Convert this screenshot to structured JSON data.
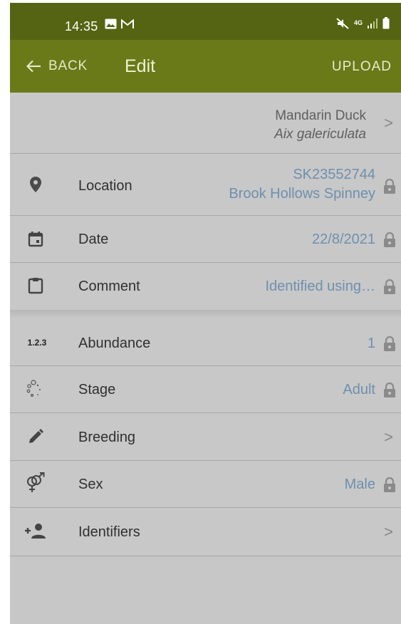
{
  "status_bar": {
    "time": "14:35",
    "network": "4G"
  },
  "app_bar": {
    "back_label": "BACK",
    "title": "Edit",
    "upload_label": "UPLOAD"
  },
  "species": {
    "common_name": "Mandarin Duck",
    "latin_name": "Aix galericulata"
  },
  "attributes": {
    "location": {
      "label": "Location",
      "grid_ref": "SK23552744",
      "place": "Brook Hollows Spinney",
      "locked": true
    },
    "date": {
      "label": "Date",
      "value": "22/8/2021",
      "locked": true
    },
    "comment": {
      "label": "Comment",
      "value": "Identified using…",
      "locked": true
    },
    "abundance": {
      "label": "Abundance",
      "value": "1",
      "locked": true,
      "icon_text": "1.2.3"
    },
    "stage": {
      "label": "Stage",
      "value": "Adult",
      "locked": true
    },
    "breeding": {
      "label": "Breeding"
    },
    "sex": {
      "label": "Sex",
      "value": "Male",
      "locked": true
    },
    "identifiers": {
      "label": "Identifiers"
    }
  },
  "colors": {
    "status_bar_bg": "#556412",
    "app_bar_bg": "#6a7a18",
    "row_bg": "#c8c8c8",
    "value_text": "#6f8fae"
  }
}
